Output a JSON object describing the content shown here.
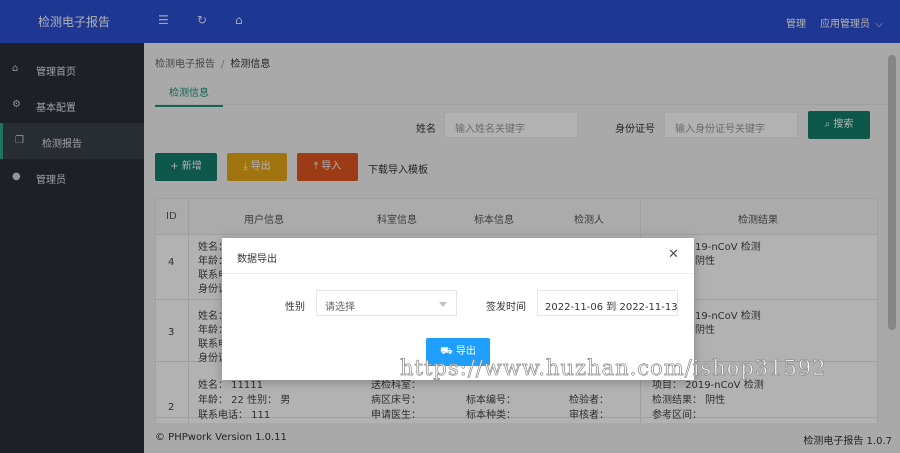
{
  "header": {
    "brand": "检测电子报告",
    "icons": [
      "menu-collapse-icon",
      "refresh-icon",
      "home-icon"
    ],
    "manage_link": "管理",
    "user_menu": "应用管理员",
    "colors": {
      "header_bg": "#2b4fd1",
      "sidebar_bg": "#2a2f38",
      "accent": "#137f6b"
    }
  },
  "sidebar": {
    "items": [
      {
        "label": "管理首页",
        "icon": "home-icon"
      },
      {
        "label": "基本配置",
        "icon": "gear-icon"
      },
      {
        "label": "检测报告",
        "icon": "copy-icon",
        "active": true
      },
      {
        "label": "管理员",
        "icon": "user-icon"
      }
    ]
  },
  "breadcrumb": {
    "root": "检测电子报告",
    "separator": "/",
    "current": "检测信息"
  },
  "tabs": [
    {
      "label": "检测信息",
      "active": true
    }
  ],
  "search": {
    "name_label": "姓名",
    "name_placeholder": "输入姓名关键字",
    "id_label": "身份证号",
    "id_placeholder": "输入身份证号关键字",
    "search_button": "搜索"
  },
  "toolbar": {
    "add": "新增",
    "export": "导出",
    "import": "导入",
    "download_template": "下载导入模板"
  },
  "table": {
    "columns": [
      "ID",
      "用户信息",
      "科室信息",
      "标本信息",
      "检测人",
      "检测结果"
    ],
    "rows": [
      {
        "id": "4",
        "user": [
          "姓名：",
          "年龄：",
          "联系电",
          "身份证"
        ],
        "result": [
          "19-nCoV 检测",
          "阴性"
        ]
      },
      {
        "id": "3",
        "user": [
          "姓名：",
          "年龄：",
          "联系电",
          "身份证"
        ],
        "result": [
          "19-nCoV 检测",
          "阴性"
        ]
      },
      {
        "id": "2",
        "user": [
          "姓名：  11111",
          "年龄：  22   性别：  男",
          "联系电话：  111"
        ],
        "dept": [
          "送检科室：",
          "病区床号：",
          "申请医生："
        ],
        "specimen": [
          "",
          "标本编号：",
          "标本种类："
        ],
        "tester": [
          "",
          "检验者：",
          "审核者："
        ],
        "result": [
          "项目：  2019-nCoV 检测",
          "检测结果：  阴性",
          "参考区间："
        ]
      }
    ]
  },
  "footer": {
    "left": "© PHPwork Version 1.0.11",
    "right": "检测电子报告 1.0.7"
  },
  "modal": {
    "title": "数据导出",
    "gender_label": "性别",
    "gender_value": "请选择",
    "date_label": "签发时间",
    "date_value": "2022-11-06 到 2022-11-13",
    "export_button": "导出"
  },
  "watermark": "https://www.huzhan.com/ishop31592"
}
